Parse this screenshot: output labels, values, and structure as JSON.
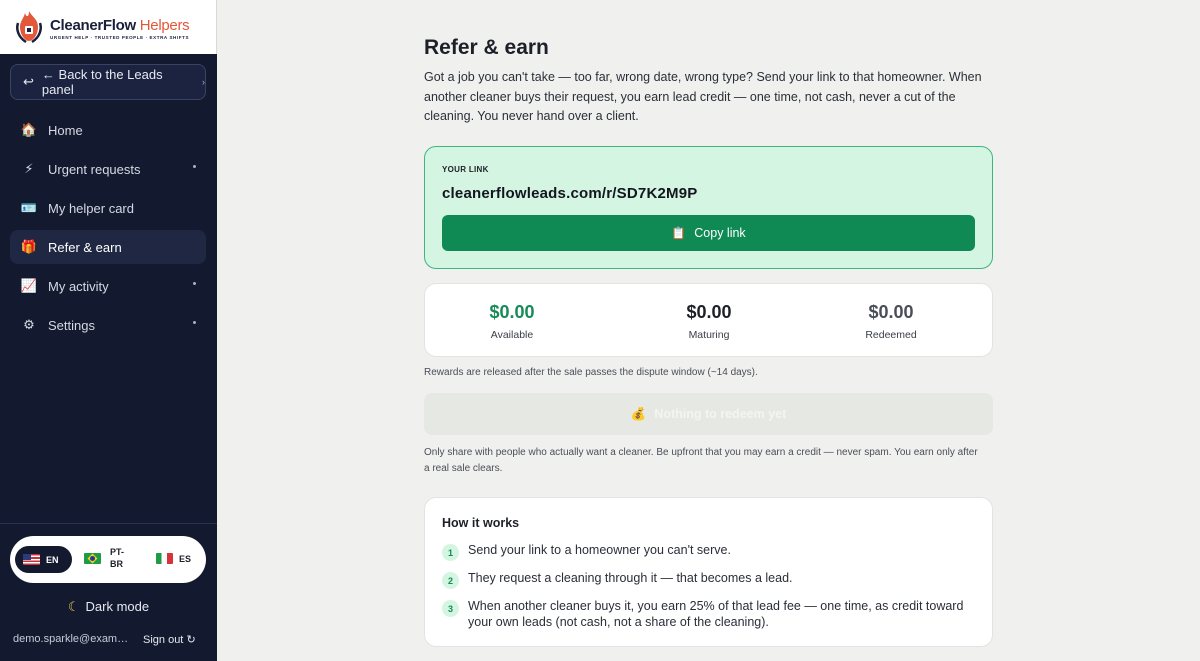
{
  "brand": {
    "name": "CleanerFlow",
    "suffix": "Helpers",
    "tagline": "URGENT HELP · TRUSTED PEOPLE · EXTRA SHIFTS"
  },
  "sidebar": {
    "back_label": "← Back to the Leads panel",
    "items": [
      {
        "label": "Home",
        "icon": "house-icon",
        "glyph": "🏠",
        "active": false,
        "has_submenu": false
      },
      {
        "label": "Urgent requests",
        "icon": "lightning-icon",
        "glyph": "⚡",
        "active": false,
        "has_submenu": true
      },
      {
        "label": "My helper card",
        "icon": "id-card-icon",
        "glyph": "🪪",
        "active": false,
        "has_submenu": false
      },
      {
        "label": "Refer & earn",
        "icon": "gift-icon",
        "glyph": "🎁",
        "active": true,
        "has_submenu": false
      },
      {
        "label": "My activity",
        "icon": "chart-icon",
        "glyph": "📈",
        "active": false,
        "has_submenu": true
      },
      {
        "label": "Settings",
        "icon": "gear-icon",
        "glyph": "⚙",
        "active": false,
        "has_submenu": true
      }
    ],
    "languages": [
      {
        "code": "EN",
        "selected": true
      },
      {
        "code": "PT-BR",
        "selected": false
      },
      {
        "code": "ES",
        "selected": false
      }
    ],
    "dark_mode_label": "Dark mode",
    "account_email": "demo.sparkle@exampl...",
    "signout_label": "Sign out"
  },
  "main": {
    "title": "Refer & earn",
    "intro": "Got a job you can't take — too far, wrong date, wrong type? Send your link to that homeowner. When another cleaner buys their request, you earn lead credit — one time, not cash, never a cut of the cleaning. You never hand over a client.",
    "link_card": {
      "label": "YOUR LINK",
      "url": "cleanerflowleads.com/r/SD7K2M9P",
      "copy_label": "Copy link"
    },
    "stats": [
      {
        "amount": "$0.00",
        "label": "Available"
      },
      {
        "amount": "$0.00",
        "label": "Maturing"
      },
      {
        "amount": "$0.00",
        "label": "Redeemed"
      }
    ],
    "release_note": "Rewards are released after the sale passes the dispute window (~14 days).",
    "redeem_label": "Nothing to redeem yet",
    "share_note": "Only share with people who actually want a cleaner. Be upfront that you may earn a credit — never spam. You earn only after a real sale clears.",
    "how": {
      "title": "How it works",
      "steps": [
        {
          "num": "1",
          "text": "Send your link to a homeowner you can't serve."
        },
        {
          "num": "2",
          "text": "They request a cleaning through it — that becomes a lead."
        },
        {
          "num": "3",
          "text": "When another cleaner buys it, you earn 25% of that lead fee — one time, as credit toward your own leads (not cash, not a share of the cleaning)."
        }
      ]
    }
  },
  "colors": {
    "sidebar_bg": "#131a30",
    "accent_green": "#0f8a55",
    "link_card_bg": "#d4f5e2",
    "page_bg": "#f0f1ee"
  }
}
